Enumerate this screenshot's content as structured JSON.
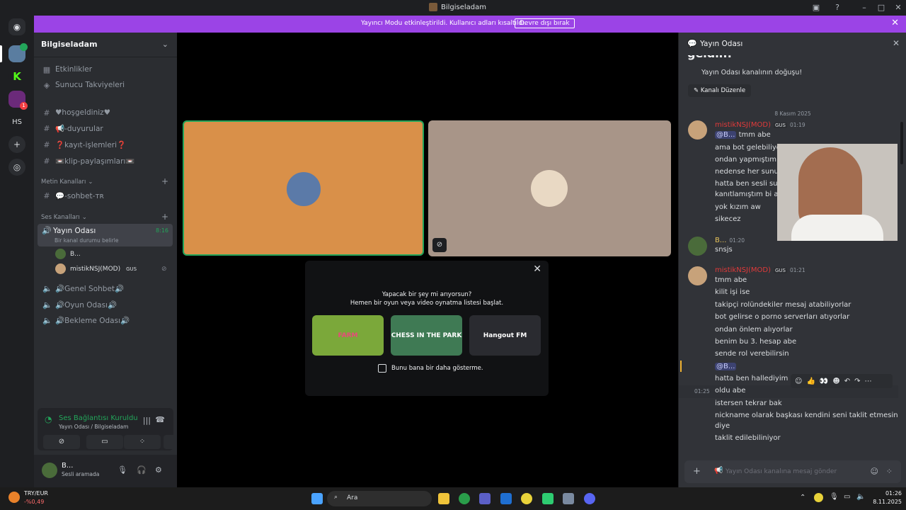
{
  "window": {
    "title": "Bilgiseladam"
  },
  "banner": {
    "message": "Yayıncı Modu etkinleştirildi. Kullanıcı adları kısaltıldı.",
    "button": "Devre dışı bırak"
  },
  "servers": {
    "badge1": "1"
  },
  "sidebar": {
    "guild_name": "Bilgiseladam",
    "top_items": [
      "Etkinlikler",
      "Sunucu Takviyeleri"
    ],
    "channels": [
      "♥hoşgeldiniz♥",
      "📢-duyurular",
      "❓kayıt-işlemleri❓",
      "📼klip-paylaşımları📼"
    ],
    "text_category": "Metin Kanalları",
    "text_channels": [
      "💬-sohbet-ᴛʀ"
    ],
    "voice_category": "Ses Kanalları",
    "active_voice": {
      "name": "Yayın Odası",
      "status": "Bir kanal durumu belirle",
      "time": "8:16"
    },
    "voice_users": [
      {
        "name": "B..."
      },
      {
        "name": "mistikNSJ(MOD)",
        "tag": "GUS"
      }
    ],
    "voice_channels": [
      "🔊Genel Sohbet🔊",
      "🔊Oyun Odası🔊",
      "🔊Bekleme Odası🔊"
    ]
  },
  "voice_panel": {
    "status": "Ses Bağlantısı Kuruldu",
    "location": "Yayın Odası / Bilgiseladam"
  },
  "user": {
    "name": "B...",
    "status": "Sesli aramada"
  },
  "activity_modal": {
    "line1": "Yapacak bir şey mi arıyorsun?",
    "line2": "Hemen bir oyun veya video oynatma listesi başlat.",
    "activities": [
      "FARM",
      "CHESS IN THE PARK",
      "Hangout FM"
    ],
    "checkbox_label": "Bunu bana bir daha gösterme."
  },
  "chat": {
    "channel": "Yayın Odası",
    "welcome_title": "geldin!",
    "welcome_sub": "Yayın Odası kanalının doğuşu!",
    "edit_button": "Kanalı Düzenle",
    "date_divider": "8 Kasım 2025",
    "groups": [
      {
        "user": "mistikNSJ(MOD)",
        "tag": "GUS",
        "time": "01:19",
        "mention": "@B...",
        "lines": [
          "tmm abe",
          "ama bot gelebiliyor",
          "ondan yapmıştım",
          "nedense her sunucu",
          "hatta ben sesli sunu",
          "kanıtlamıştım bi ara",
          "yok kızım aw",
          "sikecez"
        ]
      },
      {
        "user": "B...",
        "time": "01:20",
        "lines": [
          "snsjs"
        ]
      },
      {
        "user": "mistikNSJ(MOD)",
        "tag": "GUS",
        "time": "01:21",
        "lines": [
          "tmm abe",
          "kilit işi ise",
          "takipçi rolündekiler mesaj atabiliyorlar",
          "bot gelirse o porno serverları atıyorlar",
          "ondan önlem alıyorlar",
          "benim bu 3. hesap abe",
          "sende rol verebilirsin"
        ],
        "mention": "@B...",
        "lines2": [
          "hatta ben hallediyim"
        ],
        "hover_time": "01:25",
        "lines3": [
          "oldu abe",
          "istersen tekrar bak",
          "nickname olarak başkası kendini seni taklit etmesin",
          "diye",
          "taklit edilebiliniyor"
        ]
      }
    ],
    "input_placeholder": "Yayın Odası kanalına mesaj gönder"
  },
  "taskbar": {
    "ticker": "TRY/EUR",
    "ticker_change": "-%0,49",
    "search": "Ara",
    "time": "01:26",
    "date": "8.11.2025"
  }
}
